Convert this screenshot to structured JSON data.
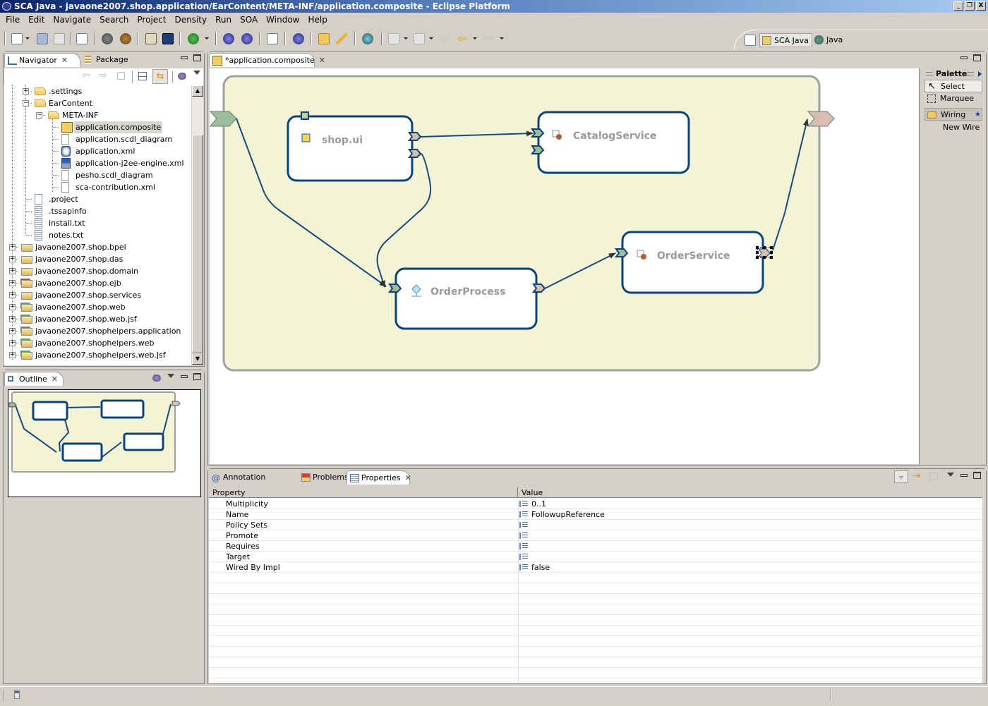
{
  "window": {
    "title": "SCA Java - javaone2007.shop.application/EarContent/META-INF/application.composite - Eclipse Platform",
    "controls": [
      "_",
      "▫",
      "X"
    ]
  },
  "menu": [
    "File",
    "Edit",
    "Navigate",
    "Search",
    "Project",
    "Density",
    "Run",
    "SOA",
    "Window",
    "Help"
  ],
  "perspectives": {
    "open_perspective_icon": "open-perspective-icon",
    "items": [
      {
        "label": "SCA Java",
        "active": true
      },
      {
        "label": "Java",
        "active": false
      }
    ]
  },
  "navigator": {
    "tabs": [
      {
        "label": "Navigator",
        "active": true
      },
      {
        "label": "Package Explorer",
        "active": false
      }
    ],
    "tree": [
      {
        "label": ".settings",
        "depth": 1,
        "type": "folder",
        "expander": "+"
      },
      {
        "label": "EarContent",
        "depth": 1,
        "type": "folder",
        "expander": "-"
      },
      {
        "label": "META-INF",
        "depth": 2,
        "type": "folder",
        "expander": "-"
      },
      {
        "label": "application.composite",
        "depth": 3,
        "type": "composite",
        "selected": true
      },
      {
        "label": "application.scdl_diagram",
        "depth": 3,
        "type": "diagram"
      },
      {
        "label": "application.xml",
        "depth": 3,
        "type": "xml-app"
      },
      {
        "label": "application-j2ee-engine.xml",
        "depth": 3,
        "type": "xml-engine"
      },
      {
        "label": "pesho.scdl_diagram",
        "depth": 3,
        "type": "diagram"
      },
      {
        "label": "sca-contribution.xml",
        "depth": 3,
        "type": "xml"
      },
      {
        "label": ".project",
        "depth": 1,
        "type": "xml"
      },
      {
        "label": ".tssapinfo",
        "depth": 1,
        "type": "text"
      },
      {
        "label": "install.txt",
        "depth": 1,
        "type": "text"
      },
      {
        "label": "notes.txt",
        "depth": 1,
        "type": "text"
      },
      {
        "label": "javaone2007.shop.bpel",
        "depth": 0,
        "type": "project",
        "expander": "+"
      },
      {
        "label": "javaone2007.shop.das",
        "depth": 0,
        "type": "project",
        "expander": "+"
      },
      {
        "label": "javaone2007.shop.domain",
        "depth": 0,
        "type": "project",
        "expander": "+"
      },
      {
        "label": "javaone2007.shop.ejb",
        "depth": 0,
        "type": "project-ejb",
        "expander": "+"
      },
      {
        "label": "javaone2007.shop.services",
        "depth": 0,
        "type": "project",
        "expander": "+"
      },
      {
        "label": "javaone2007.shop.web",
        "depth": 0,
        "type": "project-web",
        "expander": "+"
      },
      {
        "label": "javaone2007.shop.web.jsf",
        "depth": 0,
        "type": "project-web",
        "expander": "+"
      },
      {
        "label": "javaone2007.shophelpers.application",
        "depth": 0,
        "type": "project-app",
        "expander": "+"
      },
      {
        "label": "javaone2007.shophelpers.web",
        "depth": 0,
        "type": "project-web",
        "expander": "+"
      },
      {
        "label": "javaone2007.shophelpers.web.jsf",
        "depth": 0,
        "type": "project-web",
        "expander": "+"
      }
    ]
  },
  "outline": {
    "tab": "Outline"
  },
  "editor": {
    "tab": "*application.composite",
    "components": [
      {
        "name": "shop.ui",
        "icon": "web-component-icon"
      },
      {
        "name": "CatalogService",
        "icon": "java-bean-icon"
      },
      {
        "name": "OrderProcess",
        "icon": "bpel-process-icon"
      },
      {
        "name": "OrderService",
        "icon": "java-bean-icon"
      }
    ],
    "colors": {
      "composite_fill": "#f3f3d6",
      "composite_border": "#a0a0a0",
      "component_border": "#0a4477",
      "service_port": "#9bbd9b",
      "reference_port": "#d9bdb0",
      "wire": "#1a4a78",
      "label": "#9a9a9a"
    }
  },
  "palette": {
    "title": "Palette",
    "tools": [
      {
        "label": "Select",
        "icon": "arrow-cursor-icon",
        "active": true
      },
      {
        "label": "Marquee",
        "icon": "marquee-icon"
      }
    ],
    "drawers": [
      {
        "label": "Wiring",
        "icon": "folder-icon",
        "items": [
          "New Wire"
        ]
      }
    ]
  },
  "bottom": {
    "tabs": [
      {
        "label": "Annotation Properties",
        "active": false
      },
      {
        "label": "Problems",
        "active": false
      },
      {
        "label": "Properties",
        "active": true
      }
    ],
    "table": {
      "columns": [
        "Property",
        "Value"
      ],
      "rows": [
        {
          "property": "Multiplicity",
          "value": "0..1"
        },
        {
          "property": "Name",
          "value": "FollowupReference"
        },
        {
          "property": "Policy Sets",
          "value": ""
        },
        {
          "property": "Promote",
          "value": ""
        },
        {
          "property": "Requires",
          "value": ""
        },
        {
          "property": "Target",
          "value": ""
        },
        {
          "property": "Wired By Impl",
          "value": "false"
        }
      ]
    }
  }
}
